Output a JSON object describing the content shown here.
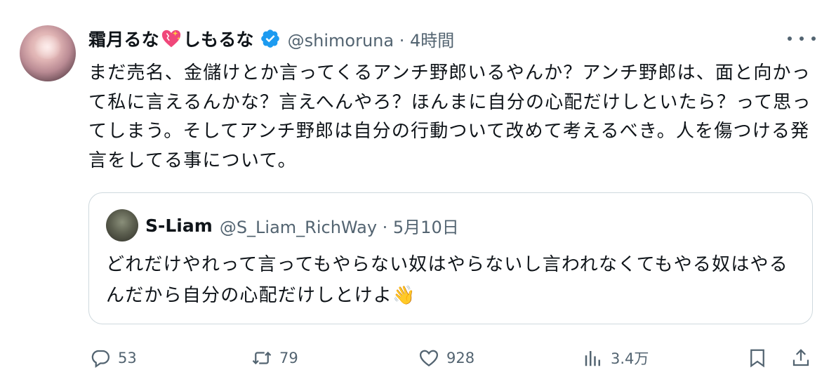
{
  "author": {
    "display_name_part1": "霜月るな",
    "display_name_part2": "しもるな",
    "handle_time": "@shimoruna · 4時間"
  },
  "body": "まだ売名、金儲けとか言ってくるアンチ野郎いるやんか？アンチ野郎は、面と向かって私に言えるんかな？言えへんやろ？ほんまに自分の心配だけしといたら？って思ってしまう。そしてアンチ野郎は自分の行動ついて改めて考えるべき。人を傷つける発言をしてる事について。",
  "quote": {
    "name": "S-Liam",
    "handle_time": "@S_Liam_RichWay · 5月10日",
    "text": "どれだけやれって言ってもやらない奴はやらないし言われなくてもやる奴はやるんだから自分の心配だけしとけよ",
    "emoji": "👋"
  },
  "actions": {
    "replies": "53",
    "reposts": "79",
    "likes": "928",
    "views": "3.4万"
  },
  "icons": [
    "heart-emoji-icon",
    "verified-badge-icon",
    "more-icon",
    "reply-icon",
    "repost-icon",
    "like-icon",
    "views-icon",
    "bookmark-icon",
    "share-icon"
  ],
  "colors": {
    "verified": "#1d9bf0",
    "muted": "#536471",
    "text": "#0f1419",
    "border": "#cfd9de"
  }
}
